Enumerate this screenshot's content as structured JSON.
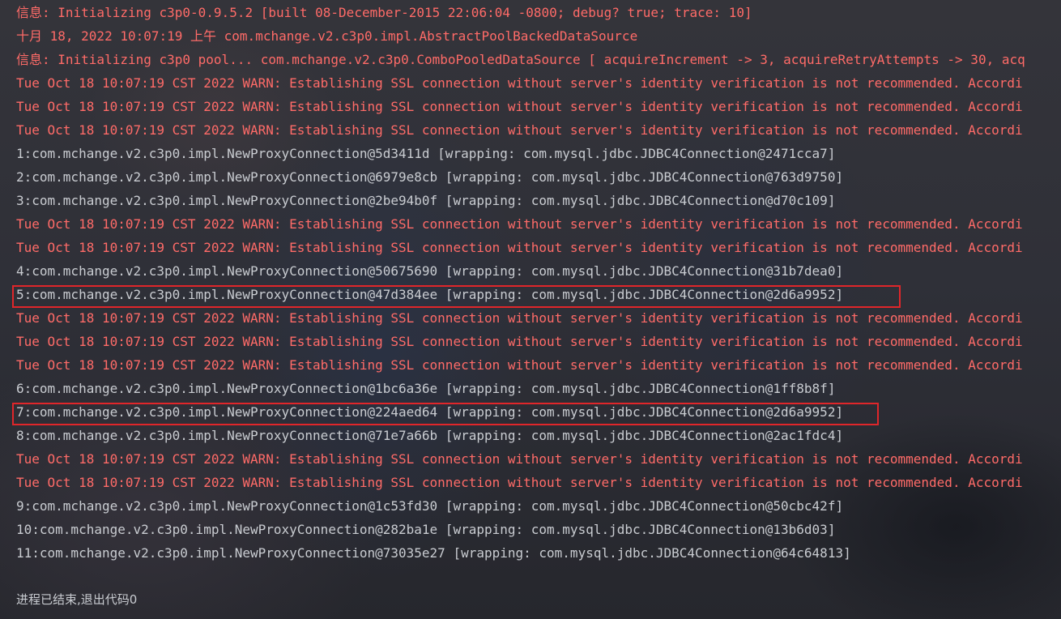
{
  "console": {
    "lines": [
      {
        "text": "信息: Initializing c3p0-0.9.5.2 [built 08-December-2015 22:06:04 -0800; debug? true; trace: 10]",
        "kind": "info"
      },
      {
        "text": "十月 18, 2022 10:07:19 上午 com.mchange.v2.c3p0.impl.AbstractPoolBackedDataSource",
        "kind": "info"
      },
      {
        "text": "信息: Initializing c3p0 pool... com.mchange.v2.c3p0.ComboPooledDataSource [ acquireIncrement -> 3, acquireRetryAttempts -> 30, acq",
        "kind": "info"
      },
      {
        "text": "Tue Oct 18 10:07:19 CST 2022 WARN: Establishing SSL connection without server's identity verification is not recommended. Accordi",
        "kind": "warn"
      },
      {
        "text": "Tue Oct 18 10:07:19 CST 2022 WARN: Establishing SSL connection without server's identity verification is not recommended. Accordi",
        "kind": "warn"
      },
      {
        "text": "Tue Oct 18 10:07:19 CST 2022 WARN: Establishing SSL connection without server's identity verification is not recommended. Accordi",
        "kind": "warn"
      },
      {
        "text": "1:com.mchange.v2.c3p0.impl.NewProxyConnection@5d3411d [wrapping: com.mysql.jdbc.JDBC4Connection@2471cca7]",
        "kind": "out"
      },
      {
        "text": "2:com.mchange.v2.c3p0.impl.NewProxyConnection@6979e8cb [wrapping: com.mysql.jdbc.JDBC4Connection@763d9750]",
        "kind": "out"
      },
      {
        "text": "3:com.mchange.v2.c3p0.impl.NewProxyConnection@2be94b0f [wrapping: com.mysql.jdbc.JDBC4Connection@d70c109]",
        "kind": "out"
      },
      {
        "text": "Tue Oct 18 10:07:19 CST 2022 WARN: Establishing SSL connection without server's identity verification is not recommended. Accordi",
        "kind": "warn"
      },
      {
        "text": "Tue Oct 18 10:07:19 CST 2022 WARN: Establishing SSL connection without server's identity verification is not recommended. Accordi",
        "kind": "warn"
      },
      {
        "text": "4:com.mchange.v2.c3p0.impl.NewProxyConnection@50675690 [wrapping: com.mysql.jdbc.JDBC4Connection@31b7dea0]",
        "kind": "out"
      },
      {
        "text": "5:com.mchange.v2.c3p0.impl.NewProxyConnection@47d384ee [wrapping: com.mysql.jdbc.JDBC4Connection@2d6a9952]",
        "kind": "out",
        "highlighted": true
      },
      {
        "text": "Tue Oct 18 10:07:19 CST 2022 WARN: Establishing SSL connection without server's identity verification is not recommended. Accordi",
        "kind": "warn"
      },
      {
        "text": "Tue Oct 18 10:07:19 CST 2022 WARN: Establishing SSL connection without server's identity verification is not recommended. Accordi",
        "kind": "warn"
      },
      {
        "text": "Tue Oct 18 10:07:19 CST 2022 WARN: Establishing SSL connection without server's identity verification is not recommended. Accordi",
        "kind": "warn"
      },
      {
        "text": "6:com.mchange.v2.c3p0.impl.NewProxyConnection@1bc6a36e [wrapping: com.mysql.jdbc.JDBC4Connection@1ff8b8f]",
        "kind": "out"
      },
      {
        "text": "7:com.mchange.v2.c3p0.impl.NewProxyConnection@224aed64 [wrapping: com.mysql.jdbc.JDBC4Connection@2d6a9952]",
        "kind": "out",
        "highlighted": true
      },
      {
        "text": "8:com.mchange.v2.c3p0.impl.NewProxyConnection@71e7a66b [wrapping: com.mysql.jdbc.JDBC4Connection@2ac1fdc4]",
        "kind": "out"
      },
      {
        "text": "Tue Oct 18 10:07:19 CST 2022 WARN: Establishing SSL connection without server's identity verification is not recommended. Accordi",
        "kind": "warn"
      },
      {
        "text": "Tue Oct 18 10:07:19 CST 2022 WARN: Establishing SSL connection without server's identity verification is not recommended. Accordi",
        "kind": "warn"
      },
      {
        "text": "9:com.mchange.v2.c3p0.impl.NewProxyConnection@1c53fd30 [wrapping: com.mysql.jdbc.JDBC4Connection@50cbc42f]",
        "kind": "out"
      },
      {
        "text": "10:com.mchange.v2.c3p0.impl.NewProxyConnection@282ba1e [wrapping: com.mysql.jdbc.JDBC4Connection@13b6d03]",
        "kind": "out"
      },
      {
        "text": "11:com.mchange.v2.c3p0.impl.NewProxyConnection@73035e27 [wrapping: com.mysql.jdbc.JDBC4Connection@64c64813]",
        "kind": "out"
      }
    ],
    "exit_message": "进程已结束,退出代码0"
  },
  "colors": {
    "warn": "#ff6b68",
    "stdout": "#c9ccd1",
    "highlight_border": "#e0262a"
  }
}
